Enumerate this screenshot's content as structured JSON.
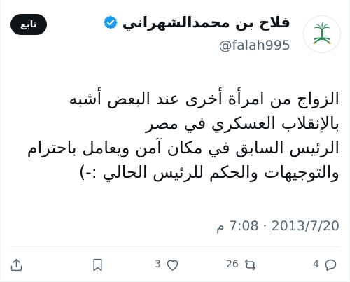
{
  "user": {
    "display_name": "فلاح بن محمدالشهراني",
    "handle": "@falah995"
  },
  "follow_button": {
    "label": "تابع"
  },
  "tweet": {
    "lines": [
      "الزواج من امرأة أخرى عند البعض أشبه",
      "بالإنقلاب العسكري في مصر",
      "الرئيس السابق في مكان آمن ويعامل باحترام",
      "والتوجيهات والحكم للرئيس الحالي :-)"
    ],
    "time": "7:08 م",
    "separator": "·",
    "date": "2013/7/20"
  },
  "actions": {
    "reply_count": "4",
    "retweet_count": "26",
    "like_count": "3"
  },
  "colors": {
    "text": "#0f1419",
    "secondary": "#536471",
    "verified": "#1d9bf0",
    "emblem_green": "#2e8b57"
  },
  "icons": [
    "verified-badge-icon",
    "saudi-emblem-icon",
    "reply-icon",
    "retweet-icon",
    "like-icon",
    "bookmark-icon",
    "share-icon"
  ]
}
